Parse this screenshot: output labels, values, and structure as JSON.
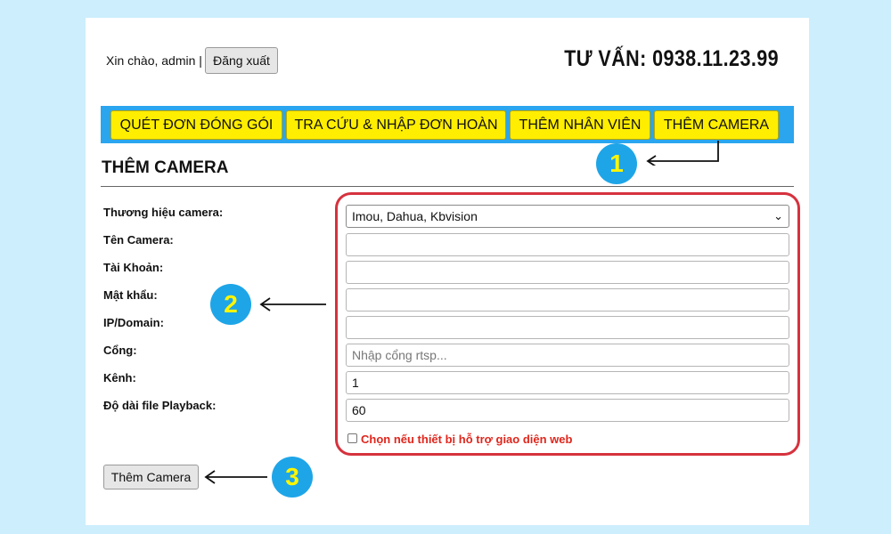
{
  "header": {
    "greeting": "Xin chào, admin |",
    "logout_label": "Đăng xuất",
    "hotline": "TƯ VẤN: 0938.11.23.99"
  },
  "nav": {
    "items": [
      {
        "label": "QUÉT ĐƠN ĐÓNG GÓI"
      },
      {
        "label": "TRA CỨU & NHẬP ĐƠN HOÀN"
      },
      {
        "label": "THÊM NHÂN VIÊN"
      },
      {
        "label": "THÊM CAMERA"
      }
    ]
  },
  "form": {
    "title": "THÊM CAMERA",
    "labels": {
      "brand": "Thương hiệu camera:",
      "camera_name": "Tên Camera:",
      "account": "Tài Khoản:",
      "password": "Mật khẩu:",
      "ip_domain": "IP/Domain:",
      "port": "Cổng:",
      "channel": "Kênh:",
      "playback_length": "Độ dài file Playback:"
    },
    "brand_selected": "Imou, Dahua, Kbvision",
    "camera_name_value": "",
    "account_value": "",
    "password_value": "",
    "ip_domain_value": "",
    "port_value": "",
    "port_placeholder": "Nhập cổng rtsp...",
    "channel_value": "1",
    "playback_length_value": "60",
    "web_checkbox_checked": false,
    "web_checkbox_label": "Chọn nếu thiết bị hỗ trợ giao diện web",
    "submit_label": "Thêm Camera"
  },
  "annotations": {
    "step1": "1",
    "step2": "2",
    "step3": "3"
  },
  "colors": {
    "background": "#cdeefc",
    "nav_bar": "#2aa5ee",
    "nav_button": "#ffee00",
    "highlight_frame": "#d6323e",
    "badge": "#1ea5e8",
    "badge_text": "#fff500",
    "checkbox_label": "#e0261c"
  }
}
